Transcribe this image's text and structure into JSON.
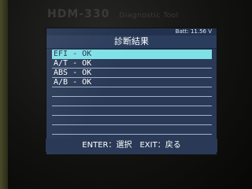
{
  "device": {
    "brand": "HDM-330",
    "subtitle": "Diagnostic Tool"
  },
  "status": {
    "battery": "Batt: 11.56 V"
  },
  "screen": {
    "title": "診断結果"
  },
  "results": [
    {
      "label": "EFI - OK",
      "selected": true
    },
    {
      "label": "A/T - OK",
      "selected": false
    },
    {
      "label": "ABS - OK",
      "selected": false
    },
    {
      "label": "A/B - OK",
      "selected": false
    },
    {
      "label": "",
      "selected": false
    },
    {
      "label": "",
      "selected": false
    },
    {
      "label": "",
      "selected": false
    },
    {
      "label": "",
      "selected": false
    },
    {
      "label": "",
      "selected": false
    },
    {
      "label": "",
      "selected": false
    }
  ],
  "footer": {
    "hint": "ENTER：選択　EXIT：戻る"
  },
  "colors": {
    "screen_bg": "#2a3a56",
    "selection": "#7fe1e6",
    "text": "#ffffff"
  }
}
